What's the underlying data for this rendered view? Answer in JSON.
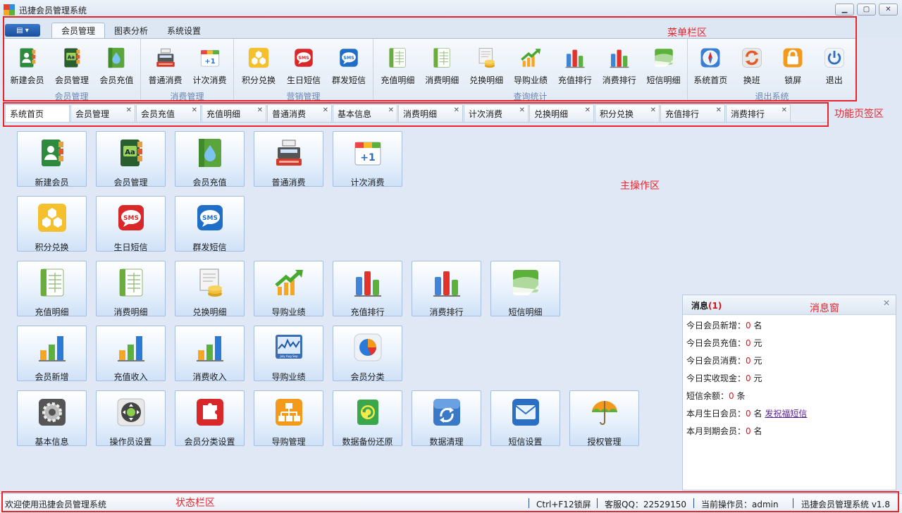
{
  "titlebar": {
    "title": "迅捷会员管理系统",
    "minimize": "▁",
    "maximize": "▢",
    "close": "✕"
  },
  "colors": {
    "accent": "#1f5aa8",
    "annotation": "#e8242c",
    "warn": "#e2141c"
  },
  "ribbon": {
    "menu_button_glyph": "▤ ▾",
    "tabs": [
      {
        "label": "会员管理",
        "active": true
      },
      {
        "label": "图表分析"
      },
      {
        "label": "系统设置"
      }
    ],
    "groups": [
      {
        "label": "会员管理",
        "items": [
          {
            "label": "新建会员",
            "icon": "new-member-book-icon"
          },
          {
            "label": "会员管理",
            "icon": "member-book-icon"
          },
          {
            "label": "会员充值",
            "icon": "water-drop-icon"
          }
        ]
      },
      {
        "label": "消费管理",
        "items": [
          {
            "label": "普通消费",
            "icon": "cash-register-icon"
          },
          {
            "label": "计次消费",
            "icon": "calendar-plus-one-icon"
          }
        ]
      },
      {
        "label": "营销管理",
        "items": [
          {
            "label": "积分兑换",
            "icon": "honeycomb-icon"
          },
          {
            "label": "生日短信",
            "icon": "sms-red-icon"
          },
          {
            "label": "群发短信",
            "icon": "sms-blue-icon"
          }
        ]
      },
      {
        "label": "查询统计",
        "items": [
          {
            "label": "充值明细",
            "icon": "ledger-icon"
          },
          {
            "label": "消费明细",
            "icon": "ledger-icon"
          },
          {
            "label": "兑换明细",
            "icon": "receipt-coins-icon"
          },
          {
            "label": "导购业绩",
            "icon": "growth-arrow-icon"
          },
          {
            "label": "充值排行",
            "icon": "bar-rank-icon"
          },
          {
            "label": "消费排行",
            "icon": "bar-rank-icon"
          },
          {
            "label": "短信明细",
            "icon": "message-note-icon"
          }
        ]
      },
      {
        "label": "退出系统",
        "items": [
          {
            "label": "系统首页",
            "icon": "compass-icon"
          },
          {
            "label": "换班",
            "icon": "switch-shift-icon"
          },
          {
            "label": "锁屏",
            "icon": "padlock-icon"
          },
          {
            "label": "退出",
            "icon": "power-icon"
          }
        ]
      }
    ]
  },
  "page_tabs": [
    {
      "label": "系统首页",
      "active": true,
      "closable": false
    },
    {
      "label": "会员管理",
      "closable": true
    },
    {
      "label": "会员充值",
      "closable": true
    },
    {
      "label": "充值明细",
      "closable": true
    },
    {
      "label": "普通消费",
      "closable": true
    },
    {
      "label": "基本信息",
      "closable": true
    },
    {
      "label": "消费明细",
      "closable": true
    },
    {
      "label": "计次消费",
      "closable": true
    },
    {
      "label": "兑换明细",
      "closable": true
    },
    {
      "label": "积分兑换",
      "closable": true
    },
    {
      "label": "充值排行",
      "closable": true
    },
    {
      "label": "消费排行",
      "closable": true
    }
  ],
  "tab_close_glyph": "✕",
  "tiles": [
    [
      {
        "label": "新建会员",
        "icon": "new-member-book-icon"
      },
      {
        "label": "会员管理",
        "icon": "member-book-icon"
      },
      {
        "label": "会员充值",
        "icon": "water-drop-icon"
      },
      {
        "label": "普通消费",
        "icon": "cash-register-icon"
      },
      {
        "label": "计次消费",
        "icon": "calendar-plus-one-icon"
      }
    ],
    [
      {
        "label": "积分兑换",
        "icon": "honeycomb-icon"
      },
      {
        "label": "生日短信",
        "icon": "sms-red-icon"
      },
      {
        "label": "群发短信",
        "icon": "sms-blue-icon"
      }
    ],
    [
      {
        "label": "充值明细",
        "icon": "ledger-icon"
      },
      {
        "label": "消费明细",
        "icon": "ledger-icon"
      },
      {
        "label": "兑换明细",
        "icon": "receipt-coins-icon"
      },
      {
        "label": "导购业绩",
        "icon": "growth-arrow-icon"
      },
      {
        "label": "充值排行",
        "icon": "bar-rank-icon"
      },
      {
        "label": "消费排行",
        "icon": "bar-rank-icon"
      },
      {
        "label": "短信明细",
        "icon": "message-note-icon"
      }
    ],
    [
      {
        "label": "会员新增",
        "icon": "bar-growth-icon"
      },
      {
        "label": "充值收入",
        "icon": "bar-growth-icon"
      },
      {
        "label": "消费收入",
        "icon": "bar-growth-icon"
      },
      {
        "label": "导购业绩",
        "icon": "line-chart-icon"
      },
      {
        "label": "会员分类",
        "icon": "pie-chart-icon"
      }
    ],
    [
      {
        "label": "基本信息",
        "icon": "gear-icon"
      },
      {
        "label": "操作员设置",
        "icon": "joystick-icon"
      },
      {
        "label": "会员分类设置",
        "icon": "puzzle-icon"
      },
      {
        "label": "导购管理",
        "icon": "org-chart-icon"
      },
      {
        "label": "数据备份还原",
        "icon": "backup-restore-icon"
      },
      {
        "label": "数据清理",
        "icon": "recycle-icon"
      },
      {
        "label": "短信设置",
        "icon": "envelope-icon"
      },
      {
        "label": "授权管理",
        "icon": "umbrella-icon"
      }
    ]
  ],
  "message_pane": {
    "title": "消息",
    "count_text": "(1)",
    "close": "✕",
    "rows": [
      {
        "label": "今日会员新增：",
        "value": "0",
        "unit": "名"
      },
      {
        "label": "今日会员充值：",
        "value": "0",
        "unit": "元"
      },
      {
        "label": "今日会员消费：",
        "value": "0",
        "unit": "元"
      },
      {
        "label": "今日实收现金：",
        "value": "0",
        "unit": "元"
      },
      {
        "label": "短信余额：",
        "value": "0",
        "unit": "条"
      },
      {
        "label": "本月生日会员：",
        "value": "0",
        "unit": "名",
        "link": "发祝福短信"
      },
      {
        "label": "本月到期会员：",
        "value": "0",
        "unit": "名"
      }
    ]
  },
  "statusbar": {
    "welcome": "欢迎使用迅捷会员管理系统",
    "lock_hint": "Ctrl+F12锁屏",
    "qq": "客服QQ：22529150",
    "operator": "当前操作员：admin",
    "version": "迅捷会员管理系统 v1.8"
  },
  "annotations": {
    "menubar": "菜单栏区",
    "tabs": "功能页签区",
    "main": "主操作区",
    "message": "消息窗",
    "status": "状态栏区"
  }
}
